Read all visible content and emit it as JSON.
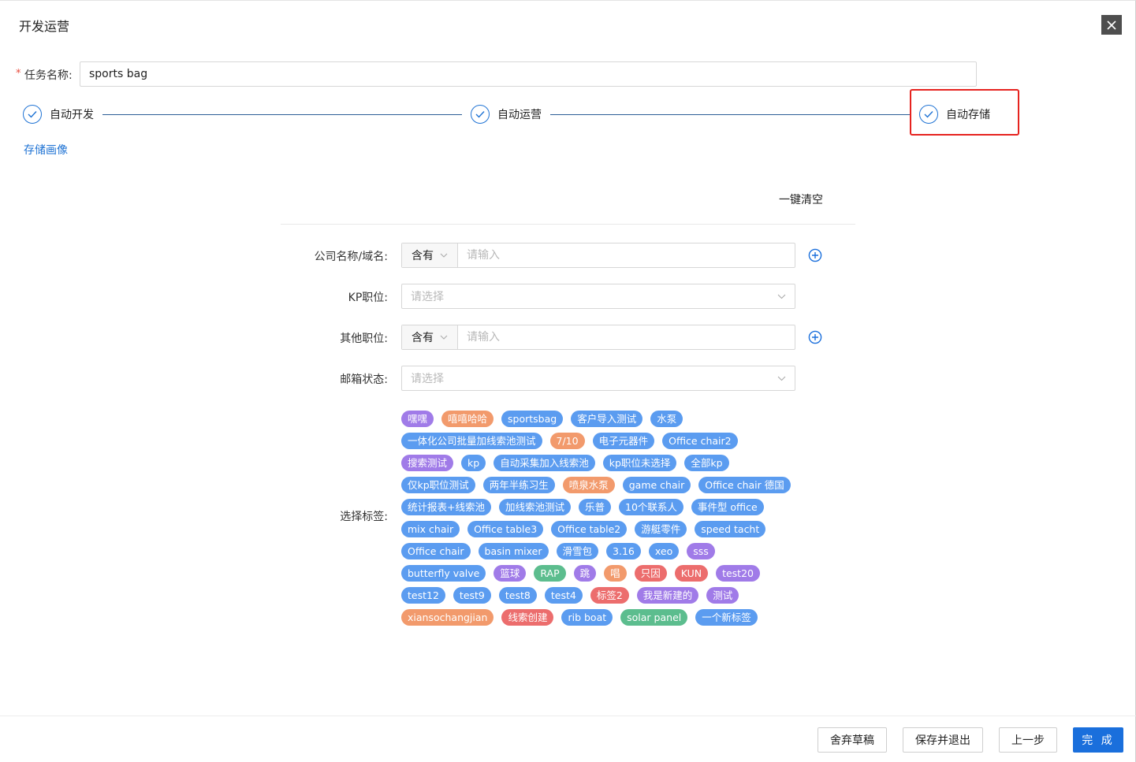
{
  "dialog": {
    "title": "开发运营"
  },
  "task": {
    "required_mark": "*",
    "label": "任务名称:",
    "value": "sports bag"
  },
  "steps": [
    {
      "label": "自动开发",
      "status": "done"
    },
    {
      "label": "自动运营",
      "status": "done"
    },
    {
      "label": "自动存储",
      "status": "done"
    }
  ],
  "links": {
    "save_portrait": "存储画像",
    "clear_all": "一键清空"
  },
  "form": {
    "company": {
      "label": "公司名称/域名:",
      "operator": "含有",
      "placeholder": "请输入"
    },
    "kp_position": {
      "label": "KP职位:",
      "placeholder": "请选择"
    },
    "other_position": {
      "label": "其他职位:",
      "operator": "含有",
      "placeholder": "请输入"
    },
    "email_status": {
      "label": "邮箱状态:",
      "placeholder": "请选择"
    },
    "tags_label": "选择标签:"
  },
  "colors": {
    "purple": "#a07be8",
    "orange": "#f29a6c",
    "blue": "#5b9cf0",
    "red": "#ec6d6d",
    "green": "#5cbd8e"
  },
  "tag_rows": [
    [
      {
        "text": "嘿嘿",
        "color": "purple"
      },
      {
        "text": "嘻嘻哈哈",
        "color": "orange"
      },
      {
        "text": "sportsbag",
        "color": "blue"
      },
      {
        "text": "客户导入测试",
        "color": "blue"
      },
      {
        "text": "水泵",
        "color": "blue"
      }
    ],
    [
      {
        "text": "一体化公司批量加线索池测试",
        "color": "blue"
      },
      {
        "text": "7/10",
        "color": "orange"
      },
      {
        "text": "电子元器件",
        "color": "blue"
      },
      {
        "text": "Office chair2",
        "color": "blue"
      }
    ],
    [
      {
        "text": "搜索测试",
        "color": "purple"
      },
      {
        "text": "kp",
        "color": "blue"
      },
      {
        "text": "自动采集加入线索池",
        "color": "blue"
      },
      {
        "text": "kp职位未选择",
        "color": "blue"
      },
      {
        "text": "全部kp",
        "color": "blue"
      }
    ],
    [
      {
        "text": "仅kp职位测试",
        "color": "blue"
      },
      {
        "text": "两年半练习生",
        "color": "blue"
      },
      {
        "text": "喷泉水泵",
        "color": "orange"
      },
      {
        "text": "game chair",
        "color": "blue"
      },
      {
        "text": "Office chair 德国",
        "color": "blue"
      }
    ],
    [
      {
        "text": "统计报表+线索池",
        "color": "blue"
      },
      {
        "text": "加线索池测试",
        "color": "blue"
      },
      {
        "text": "乐普",
        "color": "blue"
      },
      {
        "text": "10个联系人",
        "color": "blue"
      },
      {
        "text": "事件型 office",
        "color": "blue"
      }
    ],
    [
      {
        "text": "mix chair",
        "color": "blue"
      },
      {
        "text": "Office table3",
        "color": "blue"
      },
      {
        "text": "Office table2",
        "color": "blue"
      },
      {
        "text": "游艇零件",
        "color": "blue"
      },
      {
        "text": "speed tacht",
        "color": "blue"
      }
    ],
    [
      {
        "text": "Office chair",
        "color": "blue"
      },
      {
        "text": "basin mixer",
        "color": "blue"
      },
      {
        "text": "滑雪包",
        "color": "blue"
      },
      {
        "text": "3.16",
        "color": "blue"
      },
      {
        "text": "xeo",
        "color": "blue"
      },
      {
        "text": "sss",
        "color": "purple"
      }
    ],
    [
      {
        "text": "butterfly valve",
        "color": "blue"
      },
      {
        "text": "篮球",
        "color": "purple"
      },
      {
        "text": "RAP",
        "color": "green"
      },
      {
        "text": "跳",
        "color": "purple"
      },
      {
        "text": "唱",
        "color": "orange"
      },
      {
        "text": "只因",
        "color": "red"
      },
      {
        "text": "KUN",
        "color": "red"
      },
      {
        "text": "test20",
        "color": "purple"
      }
    ],
    [
      {
        "text": "test12",
        "color": "blue"
      },
      {
        "text": "test9",
        "color": "blue"
      },
      {
        "text": "test8",
        "color": "blue"
      },
      {
        "text": "test4",
        "color": "blue"
      },
      {
        "text": "标签2",
        "color": "red"
      },
      {
        "text": "我是新建的",
        "color": "purple"
      },
      {
        "text": "测试",
        "color": "purple"
      }
    ],
    [
      {
        "text": "xiansochangjian",
        "color": "orange"
      },
      {
        "text": "线索创建",
        "color": "red"
      },
      {
        "text": "rib boat",
        "color": "blue"
      },
      {
        "text": "solar panel",
        "color": "green"
      },
      {
        "text": "一个新标签",
        "color": "blue"
      }
    ]
  ],
  "footer": {
    "discard": "舍弃草稿",
    "save_exit": "保存并退出",
    "prev": "上一步",
    "finish": "完 成"
  }
}
